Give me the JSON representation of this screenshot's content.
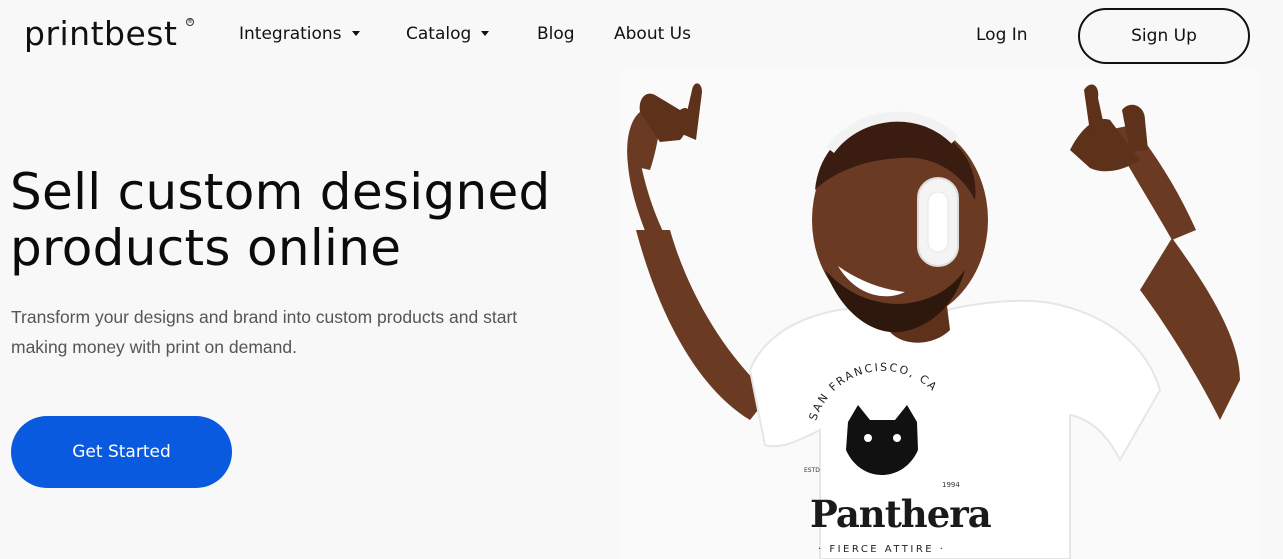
{
  "brand": {
    "name": "printbest",
    "mark": "®"
  },
  "nav": {
    "items": [
      {
        "label": "Integrations",
        "has_dropdown": true
      },
      {
        "label": "Catalog",
        "has_dropdown": true
      },
      {
        "label": "Blog",
        "has_dropdown": false
      },
      {
        "label": "About Us",
        "has_dropdown": false
      }
    ],
    "login_label": "Log In",
    "signup_label": "Sign Up"
  },
  "hero": {
    "title_line1": "Sell custom designed",
    "title_line2": "products online",
    "subtitle_line1": "Transform your designs and brand into custom products and start",
    "subtitle_line2": "making money with print on demand.",
    "cta_label": "Get Started"
  },
  "shirt_graphic": {
    "arc_text": "SAN FRANCISCO, CA",
    "est_label": "ESTD",
    "year": "1994",
    "wordmark": "Panthera",
    "tagline": "· FIERCE ATTIRE ·"
  },
  "colors": {
    "accent": "#0a5ae0",
    "background": "#f8f8f8",
    "text": "#111111",
    "subtext": "#555555"
  }
}
